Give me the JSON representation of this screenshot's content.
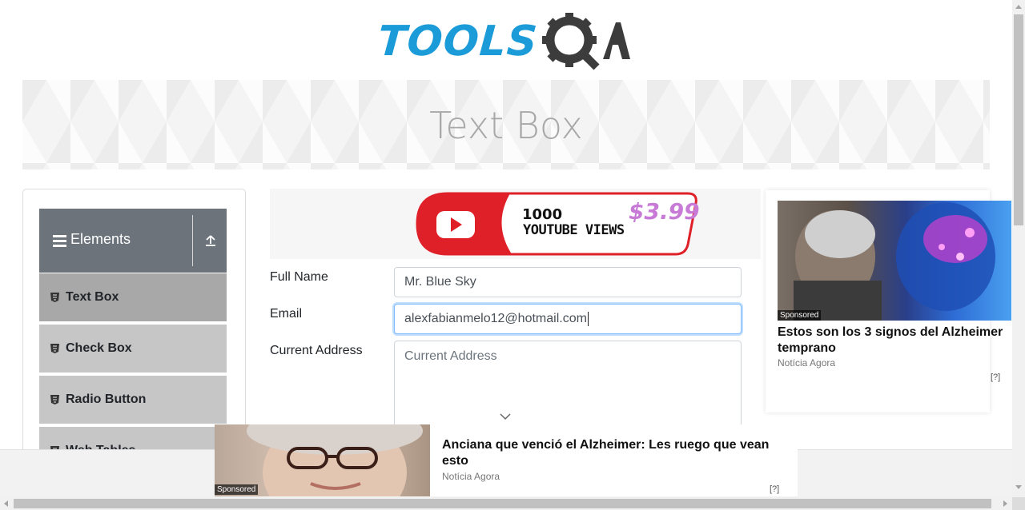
{
  "logo": {
    "text": "TOOLS",
    "suffix": "QA",
    "brand_blue": "#1b9bd7",
    "brand_dark": "#3c3c3c"
  },
  "page": {
    "title": "Text Box"
  },
  "sidebar": {
    "group_title": "Elements",
    "items": [
      {
        "label": "Text Box",
        "active": true
      },
      {
        "label": "Check Box",
        "active": false
      },
      {
        "label": "Radio Button",
        "active": false
      },
      {
        "label": "Web Tables",
        "active": false
      }
    ]
  },
  "ad_top": {
    "line1": "1000",
    "line2": "YOUTUBE VIEWS",
    "price": "$3.99"
  },
  "form": {
    "full_name_label": "Full Name",
    "full_name_value": "Mr. Blue Sky",
    "email_label": "Email",
    "email_value": "alexfabianmelo12@hotmail.com",
    "address_label": "Current Address",
    "address_placeholder": "Current Address"
  },
  "ad_right": {
    "sponsored": "Sponsored",
    "headline": "Estos son los 3 signos del Alzheimer temprano",
    "source": "Notícia Agora",
    "info": "[?]"
  },
  "ad_bottom": {
    "sponsored": "Sponsored",
    "headline": "Anciana que venció el Alzheimer: Les ruego que vean esto",
    "source": "Notícia Agora",
    "info": "[?]"
  }
}
